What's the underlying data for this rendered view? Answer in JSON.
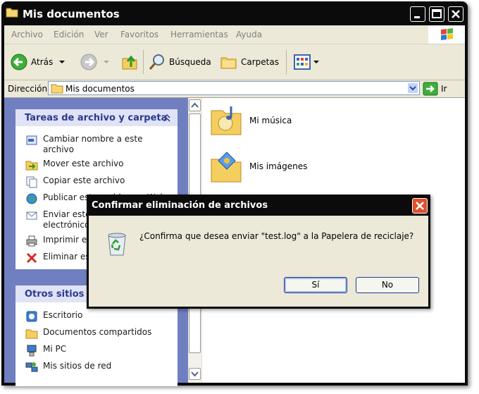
{
  "window": {
    "title": "Mis documentos"
  },
  "menu": [
    "Archivo",
    "Edición",
    "Ver",
    "Favoritos",
    "Herramientas",
    "Ayuda"
  ],
  "toolbar": {
    "back": "Atrás",
    "search": "Búsqueda",
    "folders": "Carpetas"
  },
  "address": {
    "label": "Dirección",
    "value": "Mis documentos",
    "go": "Ir"
  },
  "tasks": {
    "title": "Tareas de archivo y carpeta",
    "items": [
      {
        "line1": "Cambiar nombre a este",
        "line2": "archivo",
        "icon": "rename-icon"
      },
      {
        "line1": "Mover este archivo",
        "line2": "",
        "icon": "move-icon"
      },
      {
        "line1": "Copiar este archivo",
        "line2": "",
        "icon": "copy-icon"
      },
      {
        "line1": "Publicar este archivo en Web",
        "line2": "",
        "icon": "publish-icon"
      },
      {
        "line1": "Enviar este archivo por correo",
        "line2": "electrónico",
        "icon": "email-icon"
      },
      {
        "line1": "Imprimir este archivo",
        "line2": "",
        "icon": "print-icon"
      },
      {
        "line1": "Eliminar este archivo",
        "line2": "",
        "icon": "delete-icon"
      }
    ]
  },
  "other_places": {
    "title": "Otros sitios",
    "items": [
      {
        "label": "Escritorio",
        "icon": "desktop-icon"
      },
      {
        "label": "Documentos compartidos",
        "icon": "shared-folder-icon"
      },
      {
        "label": "Mi PC",
        "icon": "my-computer-icon"
      },
      {
        "label": "Mis sitios de red",
        "icon": "network-places-icon"
      }
    ]
  },
  "folders": [
    {
      "label": "Mi música",
      "icon": "music-folder-icon"
    },
    {
      "label": "Mis imágenes",
      "icon": "pictures-folder-icon"
    }
  ],
  "dialog": {
    "title": "Confirmar eliminación de archivos",
    "message": "¿Confirma que desea enviar \"test.log\" a la Papelera de reciclaje?",
    "yes": "Sí",
    "no": "No"
  },
  "colors": {
    "panel_bg": "#6f7fbf",
    "panel_header_text": "#2a3a8f",
    "face": "#ece9d8",
    "titlebar": "#0b0b0b"
  }
}
